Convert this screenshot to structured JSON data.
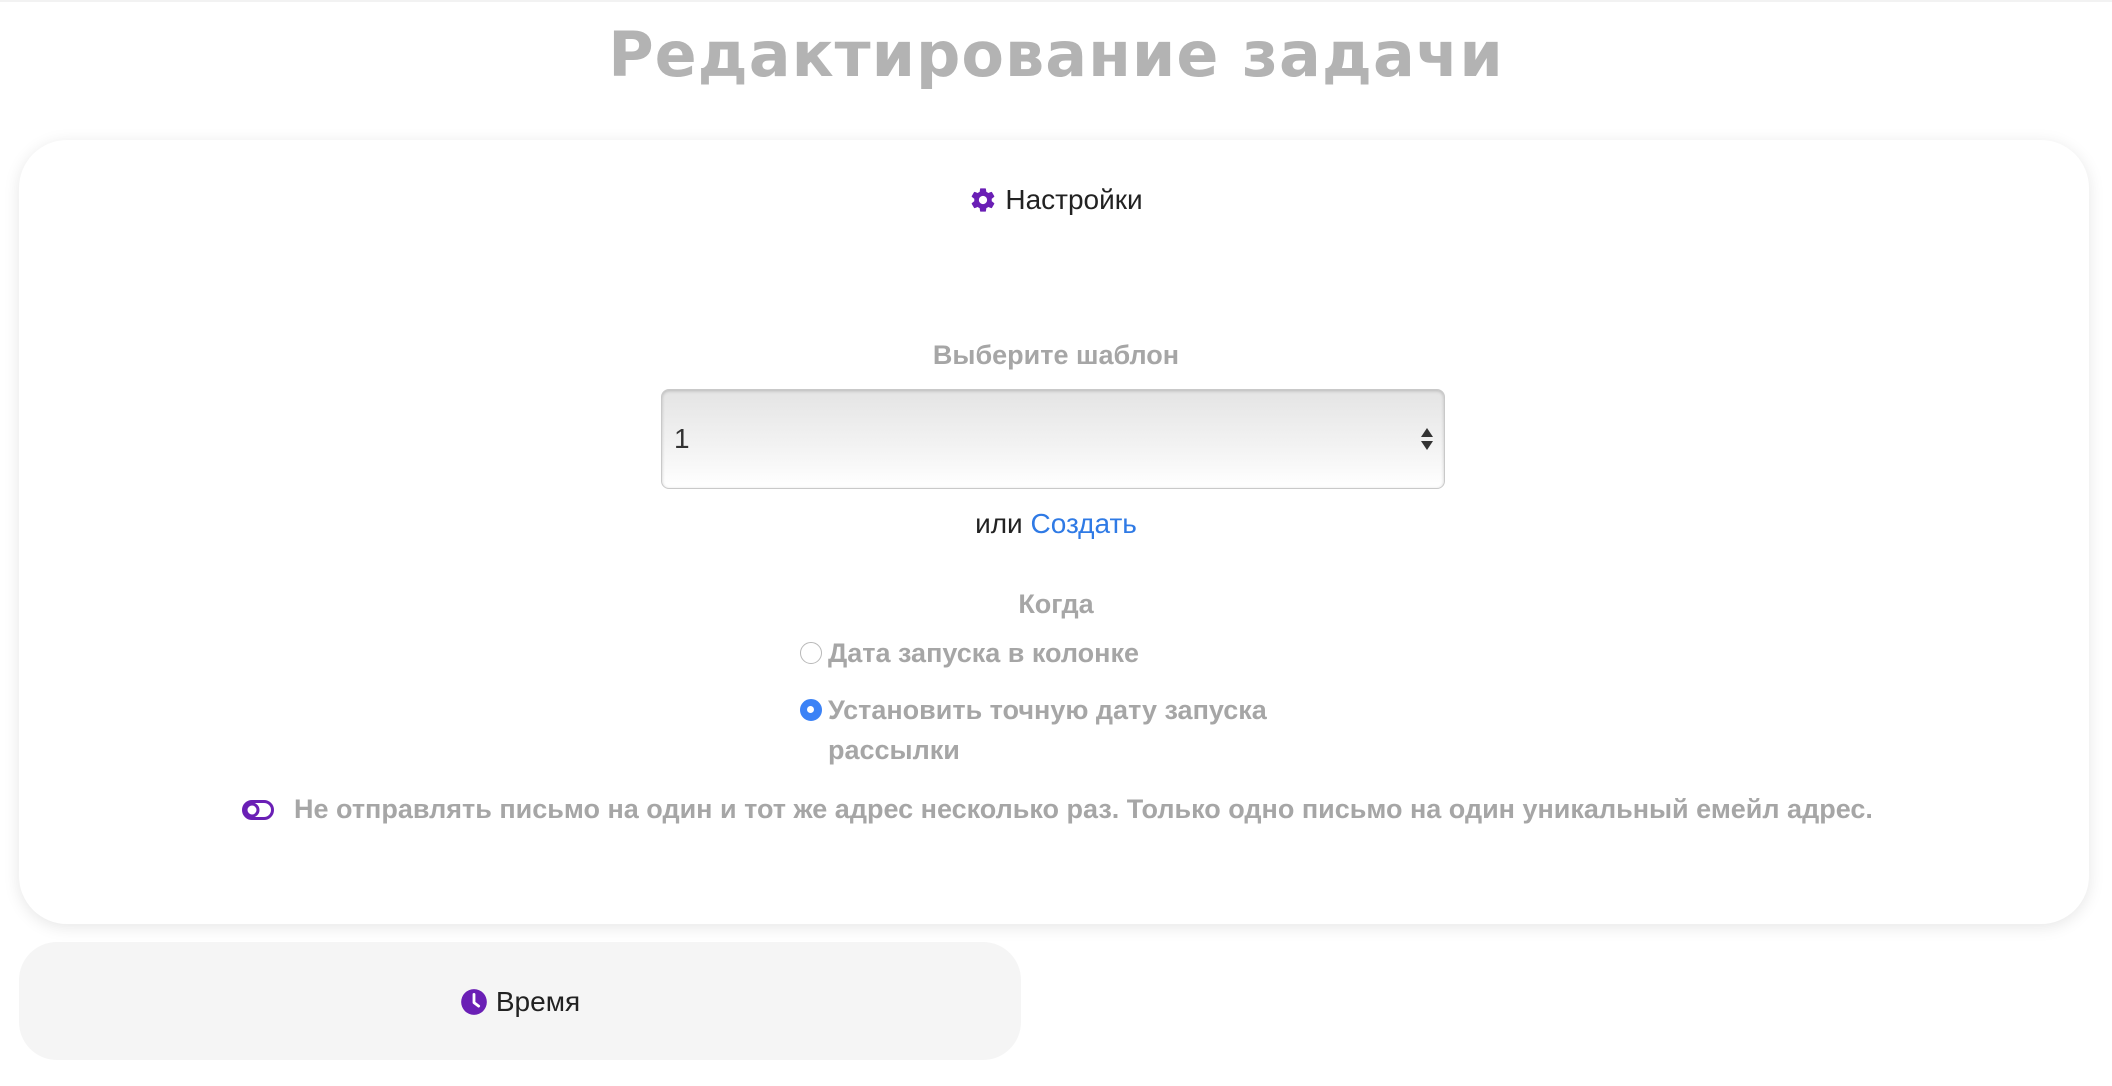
{
  "page": {
    "title": "Редактирование задачи"
  },
  "settings": {
    "header": "Настройки",
    "icon": "gear-icon",
    "template_label": "Выберите шаблон",
    "template_value": "1",
    "or_text": "или",
    "create_link": "Создать",
    "when_label": "Когда",
    "options": [
      {
        "label": "Дата запуска в колонке",
        "selected": false
      },
      {
        "label": "Установить точную дату запуска рассылки",
        "selected": true
      }
    ],
    "dedupe_toggle": {
      "label": "Не отправлять письмо на один и тот же адрес несколько раз. Только одно письмо на один уникальный емейл адрес.",
      "icon": "toggle-off-icon"
    }
  },
  "time": {
    "header": "Время",
    "icon": "clock-icon"
  },
  "colors": {
    "accent": "#6a1fb5",
    "link": "#2f7ae5",
    "radio_selected": "#3b82f6",
    "muted_text": "#a6a6a6",
    "title": "#b3b3b3"
  }
}
